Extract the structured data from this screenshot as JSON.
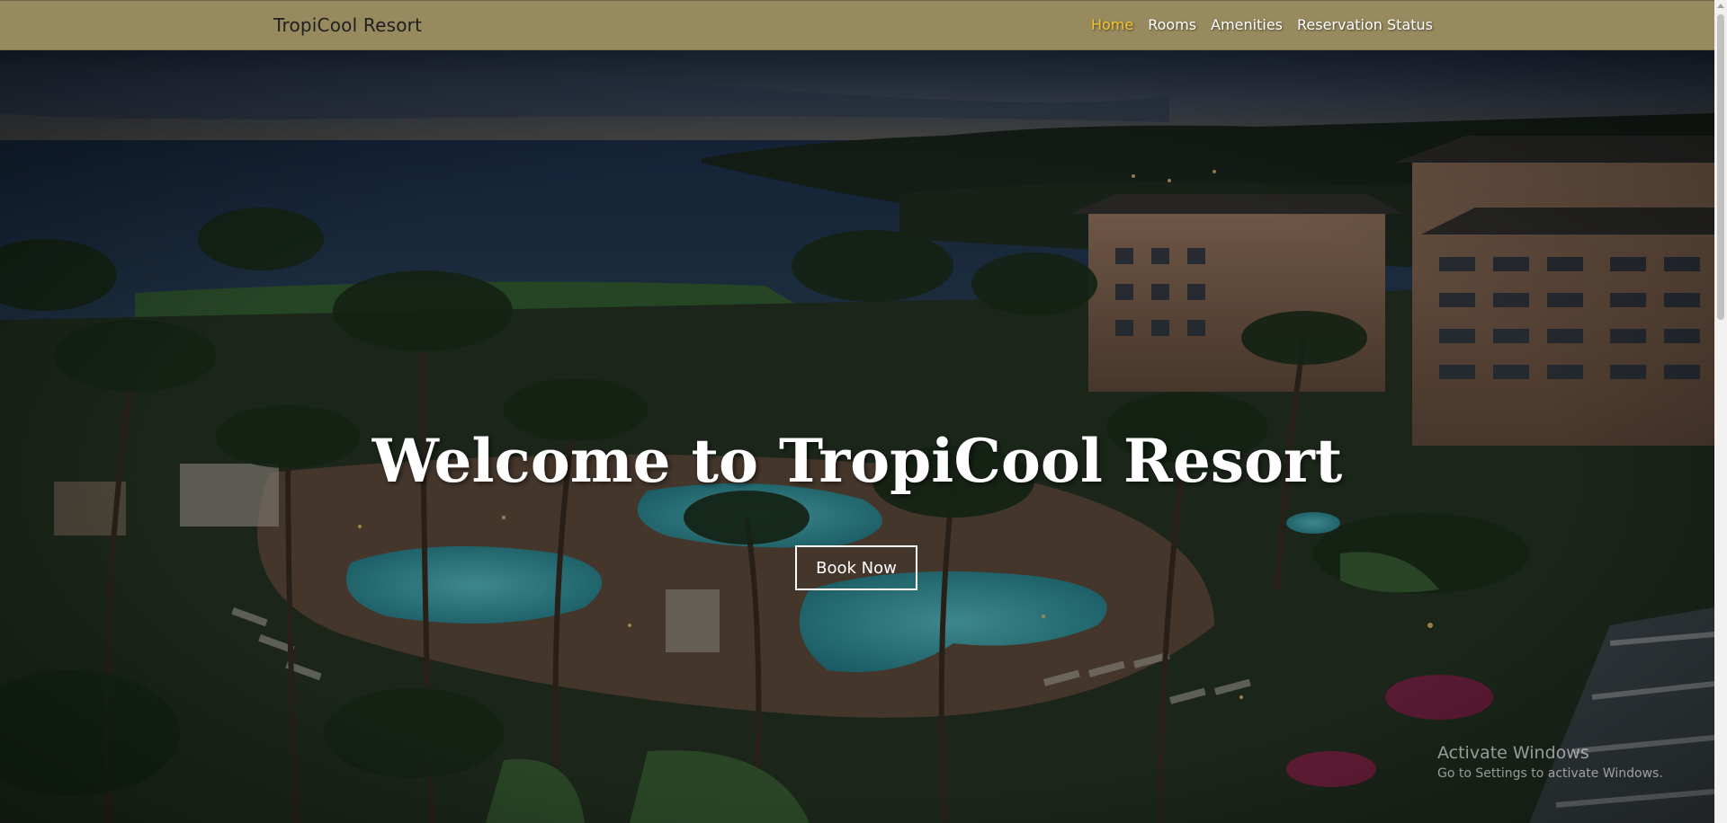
{
  "navbar": {
    "brand": "TropiCool Resort",
    "links": [
      {
        "label": "Home",
        "active": true
      },
      {
        "label": "Rooms",
        "active": false
      },
      {
        "label": "Amenities",
        "active": false
      },
      {
        "label": "Reservation Status",
        "active": false
      }
    ],
    "background_color": "#978a5e",
    "active_color": "#f4c430"
  },
  "hero": {
    "title": "Welcome to TropiCool Resort",
    "button_label": "Book Now"
  },
  "watermark": {
    "title": "Activate Windows",
    "subtitle": "Go to Settings to activate Windows."
  }
}
